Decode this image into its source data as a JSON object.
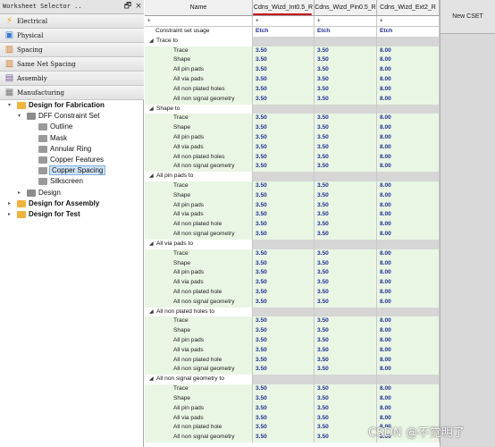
{
  "worksheet_selector": {
    "title": "Worksheet Selector ..",
    "controls": [
      "🗗",
      "×"
    ],
    "folders": [
      {
        "label": "Electrical",
        "icon": "lightning-icon",
        "glyph": "⚡",
        "color": "#e8a000"
      },
      {
        "label": "Physical",
        "icon": "physical-icon",
        "glyph": "▣",
        "color": "#3a7ccf"
      },
      {
        "label": "Spacing",
        "icon": "spacing-icon",
        "glyph": "▥",
        "color": "#cf7b2a"
      },
      {
        "label": "Same Net Spacing",
        "icon": "same-net-spacing-icon",
        "glyph": "▥",
        "color": "#cf7b2a"
      },
      {
        "label": "Assembly",
        "icon": "assembly-icon",
        "glyph": "▤",
        "color": "#7a5a9a"
      },
      {
        "label": "Manufacturing",
        "icon": "manufacturing-icon",
        "glyph": "▦",
        "color": "#7a7a7a"
      }
    ],
    "tree": [
      {
        "label": "Design for Fabrication",
        "level": 0,
        "expander": "▾",
        "bold": true,
        "icon": "folder-icon",
        "color": "#f0b33c"
      },
      {
        "label": "DFF Constraint Set",
        "level": 1,
        "expander": "▾",
        "bold": false,
        "icon": "constraint-set-icon",
        "color": "#8c8c8c"
      },
      {
        "label": "Outline",
        "level": 2,
        "expander": "",
        "bold": false,
        "icon": "worksheet-icon",
        "color": "#9a9a9a"
      },
      {
        "label": "Mask",
        "level": 2,
        "expander": "",
        "bold": false,
        "icon": "worksheet-icon",
        "color": "#9a9a9a"
      },
      {
        "label": "Annular Ring",
        "level": 2,
        "expander": "",
        "bold": false,
        "icon": "worksheet-icon",
        "color": "#9a9a9a"
      },
      {
        "label": "Copper Features",
        "level": 2,
        "expander": "",
        "bold": false,
        "icon": "worksheet-icon",
        "color": "#9a9a9a"
      },
      {
        "label": "Copper Spacing",
        "level": 2,
        "expander": "",
        "bold": false,
        "icon": "worksheet-icon",
        "color": "#9a9a9a",
        "selected": true
      },
      {
        "label": "Silkscreen",
        "level": 2,
        "expander": "",
        "bold": false,
        "icon": "worksheet-icon",
        "color": "#9a9a9a"
      },
      {
        "label": "Design",
        "level": 1,
        "expander": "▸",
        "bold": false,
        "icon": "constraint-set-icon",
        "color": "#8c8c8c"
      },
      {
        "label": "Design for Assembly",
        "level": 0,
        "expander": "▸",
        "bold": true,
        "icon": "folder-icon",
        "color": "#f0b33c"
      },
      {
        "label": "Design for Test",
        "level": 0,
        "expander": "▸",
        "bold": true,
        "icon": "folder-icon",
        "color": "#f0b33c"
      }
    ]
  },
  "spreadsheet": {
    "columns": [
      "Name",
      "Cdns_Wizd_Int0.5_R",
      "Cdns_Wizd_Pin0.5_R",
      "Cdns_Wizd_Ext2_R"
    ],
    "filter": [
      "*",
      "*",
      "*",
      "*"
    ],
    "new_cset_label": "New CSET",
    "usage_row": {
      "label": "Constraint set usage",
      "values": [
        "Etch",
        "Etch",
        "Etch"
      ]
    },
    "groups": [
      {
        "title": "Trace to",
        "expander": "◢",
        "rows": [
          {
            "name": "Trace",
            "values": [
              "3.50",
              "3.50",
              "8.00"
            ]
          },
          {
            "name": "Shape",
            "values": [
              "3.50",
              "3.50",
              "8.00"
            ]
          },
          {
            "name": "All pin pads",
            "values": [
              "3.50",
              "3.50",
              "8.00"
            ]
          },
          {
            "name": "All via pads",
            "values": [
              "3.50",
              "3.50",
              "8.00"
            ]
          },
          {
            "name": "All non plated holes",
            "values": [
              "3.50",
              "3.50",
              "8.00"
            ]
          },
          {
            "name": "All non signal geometry",
            "values": [
              "3.50",
              "3.50",
              "8.00"
            ]
          }
        ]
      },
      {
        "title": "Shape to",
        "expander": "◢",
        "rows": [
          {
            "name": "Trace",
            "values": [
              "3.50",
              "3.50",
              "8.00"
            ]
          },
          {
            "name": "Shape",
            "values": [
              "3.50",
              "3.50",
              "8.00"
            ]
          },
          {
            "name": "All pin pads",
            "values": [
              "3.50",
              "3.50",
              "8.00"
            ]
          },
          {
            "name": "All via pads",
            "values": [
              "3.50",
              "3.50",
              "8.00"
            ]
          },
          {
            "name": "All non plated holes",
            "values": [
              "3.50",
              "3.50",
              "8.00"
            ]
          },
          {
            "name": "All non signal geometry",
            "values": [
              "3.50",
              "3.50",
              "8.00"
            ]
          }
        ]
      },
      {
        "title": "All pin pads to",
        "expander": "◢",
        "rows": [
          {
            "name": "Trace",
            "values": [
              "3.50",
              "3.50",
              "8.00"
            ]
          },
          {
            "name": "Shape",
            "values": [
              "3.50",
              "3.50",
              "8.00"
            ]
          },
          {
            "name": "All pin pads",
            "values": [
              "3.50",
              "3.50",
              "8.00"
            ]
          },
          {
            "name": "All via pads",
            "values": [
              "3.50",
              "3.50",
              "8.00"
            ]
          },
          {
            "name": "All non plated hole",
            "values": [
              "3.50",
              "3.50",
              "8.00"
            ]
          },
          {
            "name": "All non signal geometry",
            "values": [
              "3.50",
              "3.50",
              "8.00"
            ]
          }
        ]
      },
      {
        "title": "All via pads to",
        "expander": "◢",
        "rows": [
          {
            "name": "Trace",
            "values": [
              "3.50",
              "3.50",
              "8.00"
            ]
          },
          {
            "name": "Shape",
            "values": [
              "3.50",
              "3.50",
              "8.00"
            ]
          },
          {
            "name": "All pin pads",
            "values": [
              "3.50",
              "3.50",
              "8.00"
            ]
          },
          {
            "name": "All via pads",
            "values": [
              "3.50",
              "3.50",
              "8.00"
            ]
          },
          {
            "name": "All non plated hole",
            "values": [
              "3.50",
              "3.50",
              "8.00"
            ]
          },
          {
            "name": "All non signal geometry",
            "values": [
              "3.50",
              "3.50",
              "8.00"
            ]
          }
        ]
      },
      {
        "title": "All non plated holes to",
        "expander": "◢",
        "rows": [
          {
            "name": "Trace",
            "values": [
              "3.50",
              "3.50",
              "8.00"
            ]
          },
          {
            "name": "Shape",
            "values": [
              "3.50",
              "3.50",
              "8.00"
            ]
          },
          {
            "name": "All pin pads",
            "values": [
              "3.50",
              "3.50",
              "8.00"
            ]
          },
          {
            "name": "All via pads",
            "values": [
              "3.50",
              "3.50",
              "8.00"
            ]
          },
          {
            "name": "All non plated hole",
            "values": [
              "3.50",
              "3.50",
              "8.00"
            ]
          },
          {
            "name": "All non signal geometry",
            "values": [
              "3.50",
              "3.50",
              "8.00"
            ]
          }
        ]
      },
      {
        "title": "All non signal geometry to",
        "expander": "◢",
        "rows": [
          {
            "name": "Trace",
            "values": [
              "3.50",
              "3.50",
              "8.00"
            ]
          },
          {
            "name": "Shape",
            "values": [
              "3.50",
              "3.50",
              "8.00"
            ]
          },
          {
            "name": "All pin pads",
            "values": [
              "3.50",
              "3.50",
              "8.00"
            ]
          },
          {
            "name": "All via pads",
            "values": [
              "3.50",
              "3.50",
              "8.00"
            ]
          },
          {
            "name": "All non plated hole",
            "values": [
              "3.50",
              "3.50",
              "8.00"
            ]
          },
          {
            "name": "All non signal geometry",
            "values": [
              "3.50",
              "3.50",
              "8.00"
            ]
          }
        ]
      }
    ]
  },
  "watermark": "CSDN @不觉明了",
  "colors": {
    "value_text": "#1f2f96",
    "data_row_bg": "#eaf6e4",
    "section_bg": "#d6d6d6",
    "selected_bg": "#cde3f7",
    "annotation_red": "#c8141e"
  }
}
